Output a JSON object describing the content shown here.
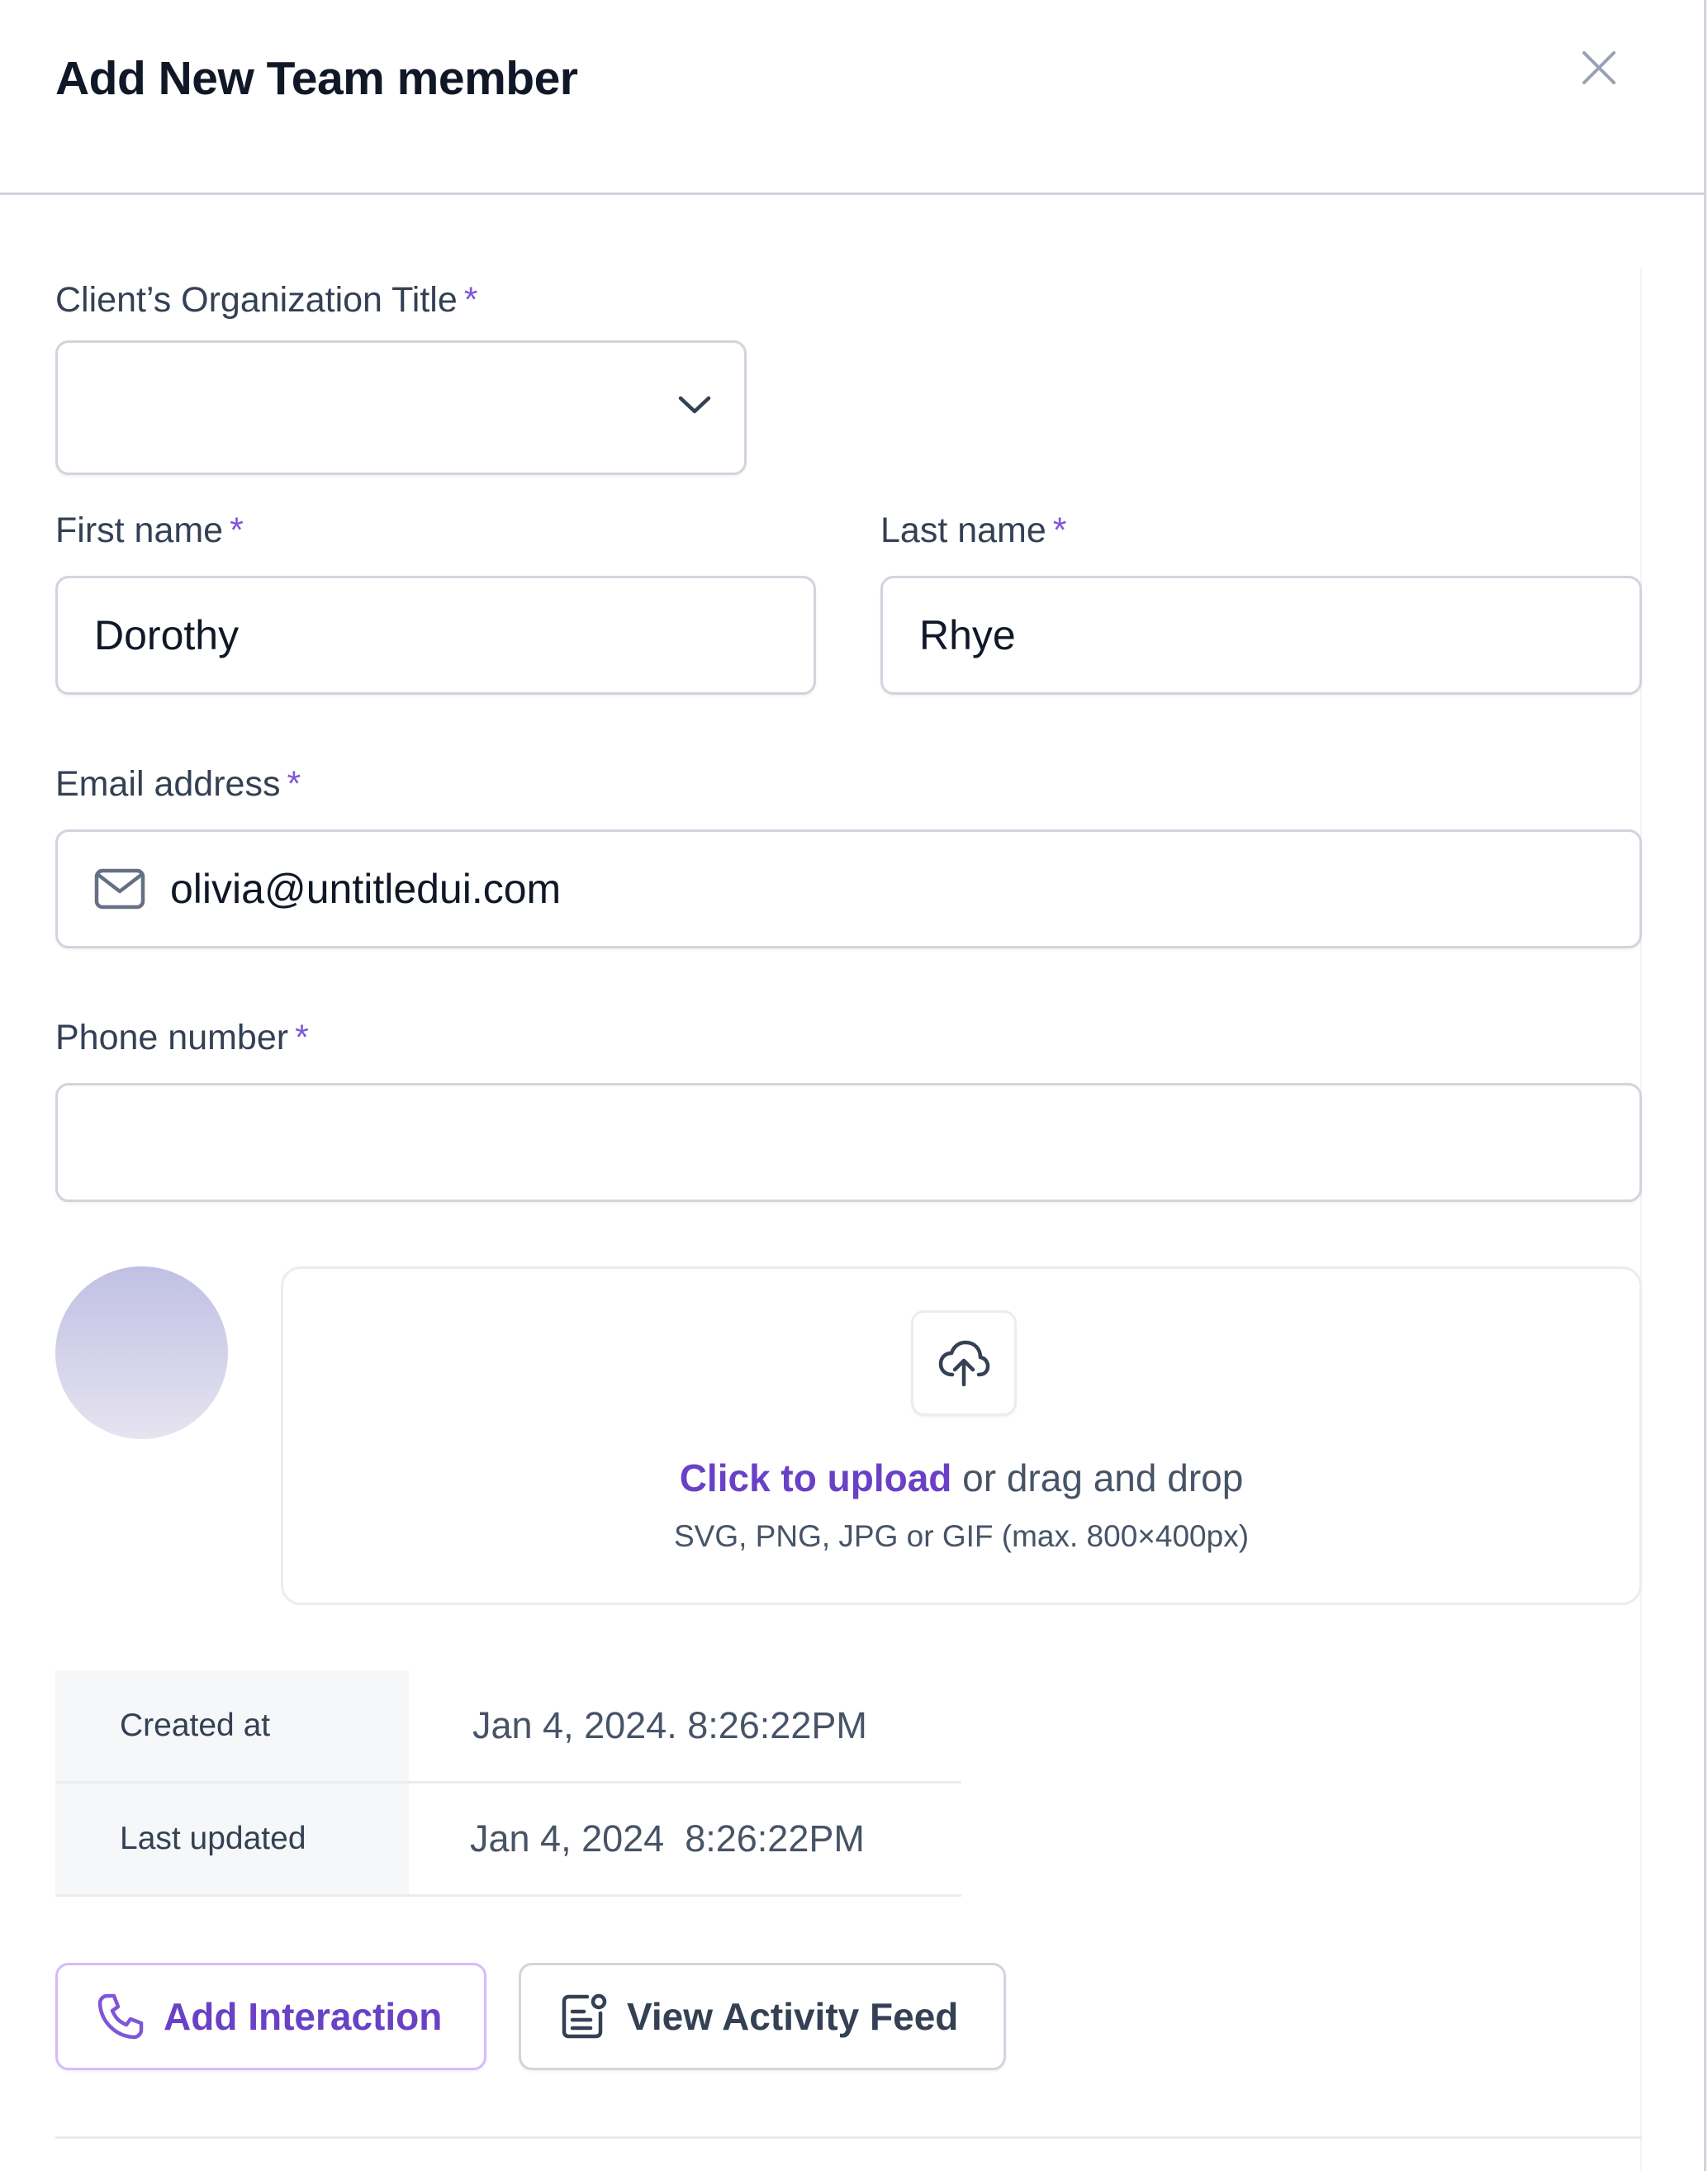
{
  "modal": {
    "title": "Add New Team member",
    "close_icon": "close-icon"
  },
  "form": {
    "organization": {
      "label": "Client’s Organization Title",
      "required_mark": "*",
      "value": "",
      "icon": "chevron-down-icon"
    },
    "first_name": {
      "label": "First name",
      "required_mark": "*",
      "value": "Dorothy"
    },
    "last_name": {
      "label": "Last name",
      "required_mark": "*",
      "value": "Rhye"
    },
    "email": {
      "label": "Email address",
      "required_mark": "*",
      "value": "olivia@untitledui.com",
      "icon": "mail-icon"
    },
    "phone": {
      "label": "Phone number",
      "required_mark": "*",
      "value": ""
    }
  },
  "upload": {
    "icon": "upload-cloud-icon",
    "link_text": "Click to upload",
    "rest_text": " or drag and drop",
    "hint": "SVG, PNG, JPG or GIF (max. 800×400px)"
  },
  "meta": [
    {
      "key": "Created at",
      "value": "Jan 4, 2024. 8:26:22PM"
    },
    {
      "key": "Last updated",
      "value": "Jan 4, 2024  8:26:22PM"
    }
  ],
  "actions": {
    "add_interaction": {
      "label": "Add Interaction",
      "icon": "phone-icon"
    },
    "view_activity_feed": {
      "label": "View Activity Feed",
      "icon": "activity-feed-icon"
    }
  },
  "colors": {
    "accent": "#7f56d9",
    "accent_dark": "#6941c6",
    "border": "#d0d5dd",
    "text_primary": "#101828",
    "text_secondary": "#344054"
  }
}
